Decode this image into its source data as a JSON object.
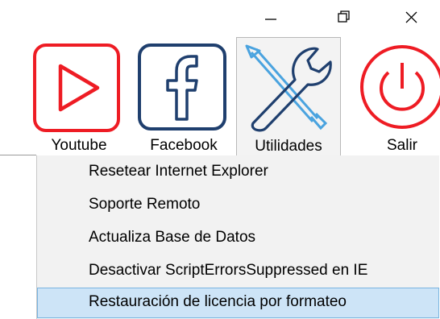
{
  "window_controls": {
    "minimize_icon": "minimize-icon",
    "restore_icon": "restore-icon",
    "close_icon": "close-icon"
  },
  "toolbar": {
    "items": [
      {
        "label": "Youtube",
        "icon": "youtube-play-icon",
        "color": "#ee1c24"
      },
      {
        "label": "Facebook",
        "icon": "facebook-icon",
        "color": "#1f3f6e"
      },
      {
        "label": "Utilidades",
        "icon": "tools-icon",
        "color": "#4aa3df",
        "selected": true
      },
      {
        "label": "Salir",
        "icon": "power-icon",
        "color": "#ee1c24"
      }
    ]
  },
  "dropdown_menu": {
    "items": [
      {
        "label": "Resetear Internet Explorer"
      },
      {
        "label": "Soporte Remoto"
      },
      {
        "label": "Actualiza Base de Datos"
      },
      {
        "label": "Desactivar ScriptErrorsSuppressed en IE"
      },
      {
        "label": "Restauración de licencia por formateo",
        "highlighted": true
      }
    ]
  },
  "colors": {
    "menu_highlight": "#cde4f7",
    "menu_highlight_border": "#79b4e0",
    "menu_background": "#f2f2f2"
  }
}
